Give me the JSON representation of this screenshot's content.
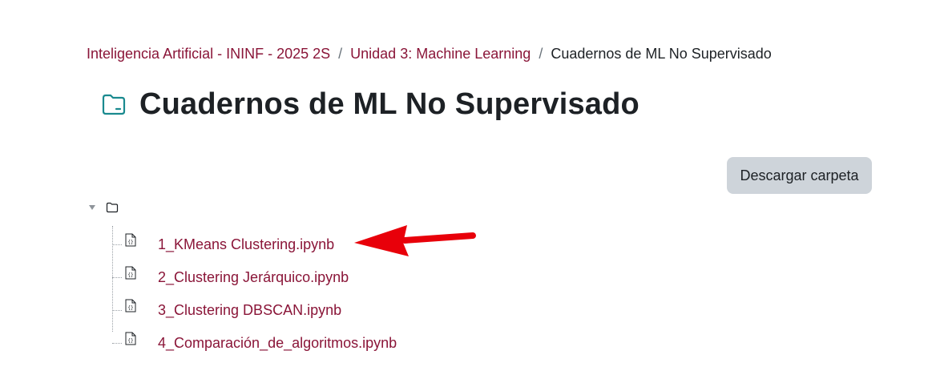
{
  "breadcrumb": {
    "items": [
      "Inteligencia Artificial - ININF - 2025 2S",
      "Unidad 3: Machine Learning",
      "Cuadernos de ML No Supervisado"
    ],
    "separator": "/"
  },
  "header": {
    "title": "Cuadernos de ML No Supervisado",
    "icon": "folder-icon"
  },
  "toolbar": {
    "download_label": "Descargar carpeta"
  },
  "tree": {
    "toggle_icon": "caret-down-icon",
    "root_icon": "folder-icon",
    "files": [
      {
        "name": "1_KMeans Clustering.ipynb",
        "icon": "code-file-icon"
      },
      {
        "name": "2_Clustering Jerárquico.ipynb",
        "icon": "code-file-icon"
      },
      {
        "name": "3_Clustering DBSCAN.ipynb",
        "icon": "code-file-icon"
      },
      {
        "name": "4_Comparación_de_algoritmos.ipynb",
        "icon": "code-file-icon"
      }
    ]
  },
  "colors": {
    "link": "#8a1538",
    "text": "#1d2125",
    "icon_accent": "#1a8a8f",
    "button_bg": "#ced4da",
    "annotation": "#e8000a"
  }
}
